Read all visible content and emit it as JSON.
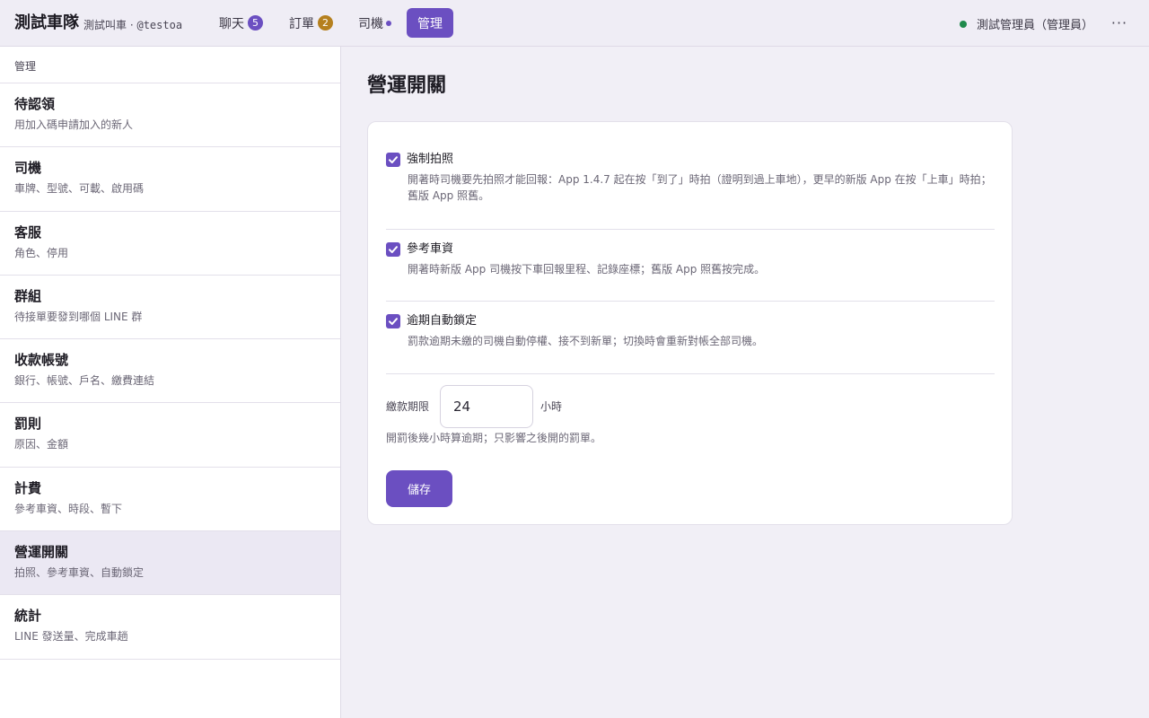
{
  "header": {
    "brand": "測試車隊",
    "subtitle": "測試叫車 ·",
    "handle": "@testoa",
    "nav": {
      "chat": {
        "label": "聊天",
        "badge": "5"
      },
      "orders": {
        "label": "訂單",
        "badge": "2"
      },
      "drivers": {
        "label": "司機"
      },
      "admin": {
        "label": "管理"
      }
    },
    "user": "測試管理員（管理員）",
    "more": "···"
  },
  "sidebar": {
    "header": "管理",
    "items": [
      {
        "title": "待認領",
        "subtitle": "用加入碼申請加入的新人"
      },
      {
        "title": "司機",
        "subtitle": "車牌、型號、可載、啟用碼"
      },
      {
        "title": "客服",
        "subtitle": "角色、停用"
      },
      {
        "title": "群組",
        "subtitle": "待接單要發到哪個 LINE 群"
      },
      {
        "title": "收款帳號",
        "subtitle": "銀行、帳號、戶名、繳費連結"
      },
      {
        "title": "罰則",
        "subtitle": "原因、金額"
      },
      {
        "title": "計費",
        "subtitle": "參考車資、時段、暫下"
      },
      {
        "title": "營運開關",
        "subtitle": "拍照、參考車資、自動鎖定"
      },
      {
        "title": "統計",
        "subtitle": "LINE 發送量、完成車趟"
      }
    ]
  },
  "main": {
    "title": "營運開關",
    "options": [
      {
        "label": "強制拍照",
        "checked": true,
        "description": "開著時司機要先拍照才能回報：App 1.4.7 起在按「到了」時拍（證明到過上車地），更早的新版 App 在按「上車」時拍；舊版 App 照舊。"
      },
      {
        "label": "參考車資",
        "checked": true,
        "description": "開著時新版 App 司機按下車回報里程、記錄座標；舊版 App 照舊按完成。"
      },
      {
        "label": "逾期自動鎖定",
        "checked": true,
        "description": "罰款逾期未繳的司機自動停權、接不到新單；切換時會重新對帳全部司機。"
      }
    ],
    "deadline": {
      "label": "繳款期限",
      "value": "24",
      "unit": "小時",
      "help": "開罰後幾小時算逾期；只影響之後開的罰單。"
    },
    "save_label": "儲存"
  },
  "colors": {
    "accent": "#6b4fc1",
    "badge_amber": "#b5801f",
    "status_online": "#1f8a4c",
    "active_item_bg": "#ebe8f3"
  }
}
